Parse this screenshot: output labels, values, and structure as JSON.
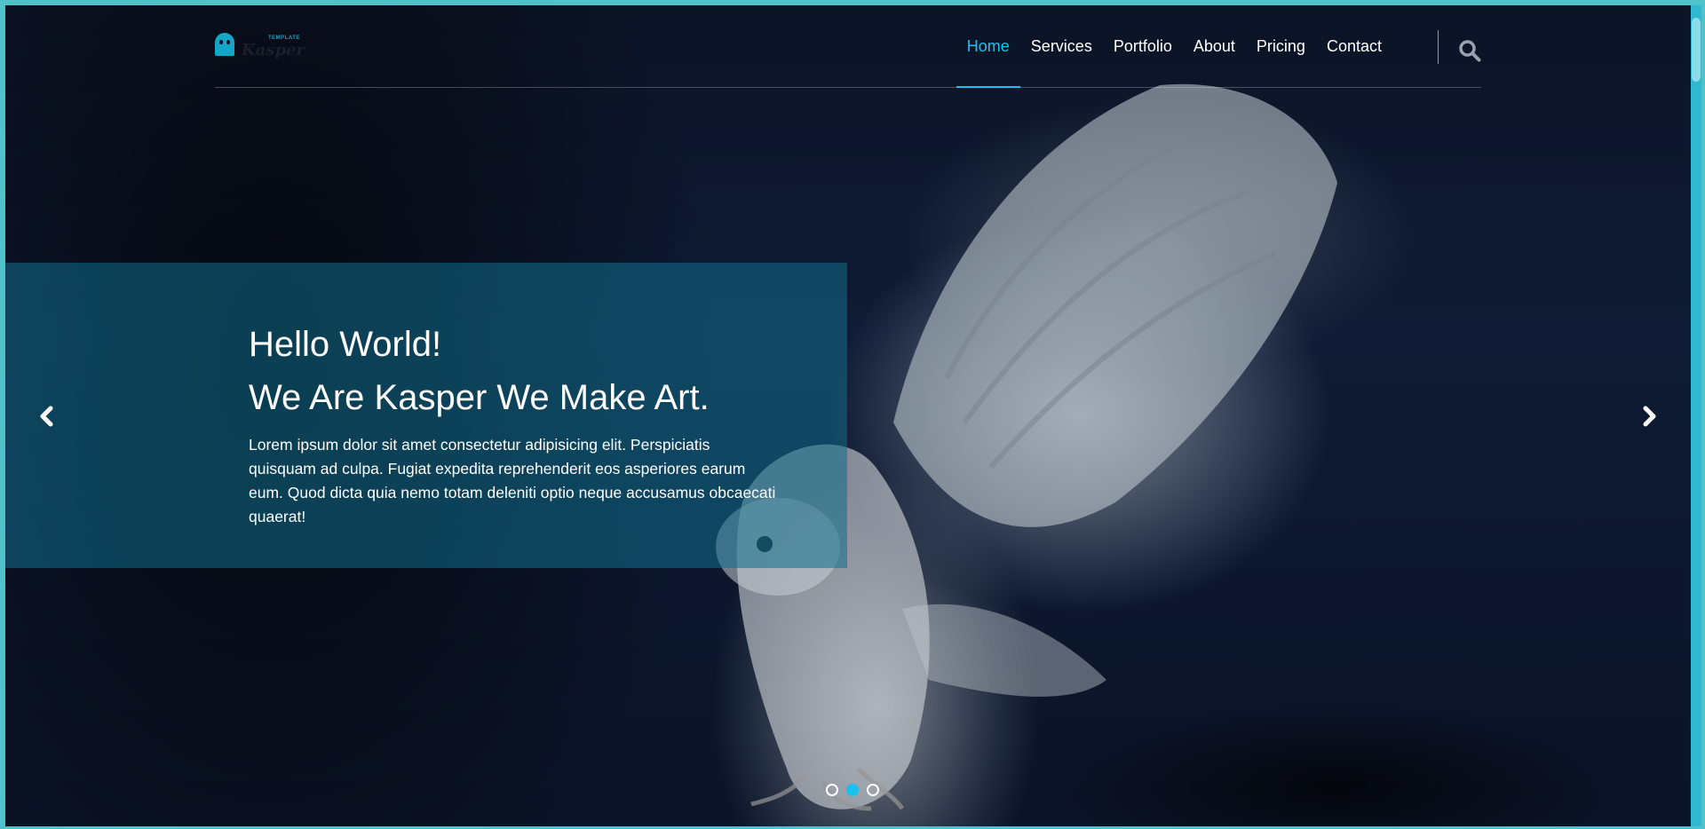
{
  "brand": {
    "logo_word": "Kasper",
    "logo_tag": "TEMPLATE",
    "accent": "#19c1f3"
  },
  "nav": {
    "items": [
      {
        "label": "Home",
        "active": true
      },
      {
        "label": "Services",
        "active": false
      },
      {
        "label": "Portfolio",
        "active": false
      },
      {
        "label": "About",
        "active": false
      },
      {
        "label": "Pricing",
        "active": false
      },
      {
        "label": "Contact",
        "active": false
      }
    ],
    "search_icon": "search-icon"
  },
  "hero": {
    "title_line1": "Hello World!",
    "title_line2": "We Are Kasper We Make Art.",
    "paragraph": "Lorem ipsum dolor sit amet consectetur adipisicing elit. Perspiciatis quisquam ad culpa. Fugiat expedita reprehenderit eos asperiores earum eum. Quod dicta quia nemo totam deleniti optio neque accusamus obcaecati quaerat!",
    "prev_icon": "chevron-left-icon",
    "next_icon": "chevron-right-icon"
  },
  "slider": {
    "dots": 3,
    "active_dot": 2
  }
}
